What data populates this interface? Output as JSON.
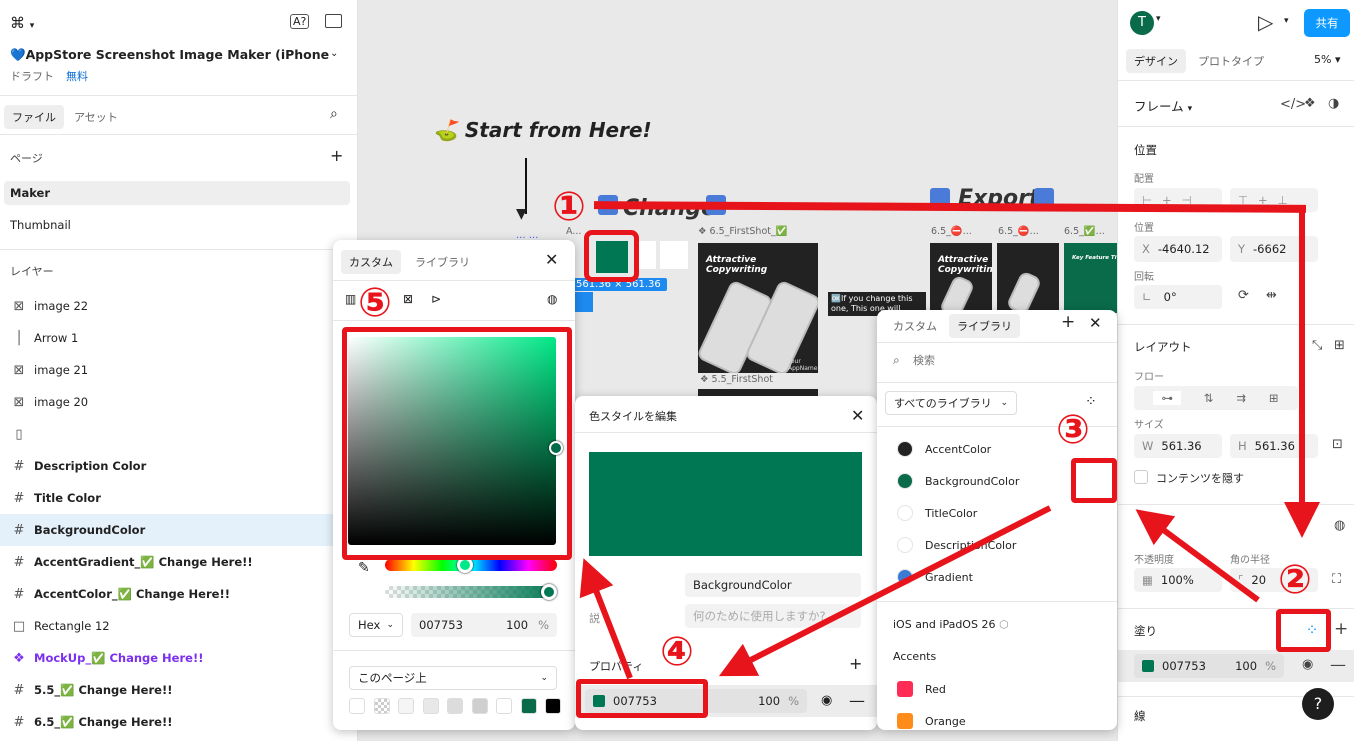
{
  "left": {
    "title": "💙AppStore Screenshot Image Maker (iPhone 1...",
    "draft": "ドラフト",
    "plan": "無料",
    "tab_file": "ファイル",
    "tab_assets": "アセット",
    "pages_label": "ページ",
    "pages": [
      "Maker",
      "Thumbnail"
    ],
    "layers_label": "レイヤー",
    "layers": [
      {
        "icon": "image-icon",
        "name": "image 22"
      },
      {
        "icon": "line-icon",
        "name": "Arrow 1"
      },
      {
        "icon": "image-icon",
        "name": "image 21"
      },
      {
        "icon": "image-icon",
        "name": "image 20"
      },
      {
        "icon": "auto-layout-icon",
        "name": ""
      },
      {
        "icon": "frame-icon",
        "name": "Description Color"
      },
      {
        "icon": "frame-icon",
        "name": "Title Color"
      },
      {
        "icon": "frame-icon",
        "name": "BackgroundColor"
      },
      {
        "icon": "frame-icon",
        "name": "AccentGradient_✅ Change Here!!"
      },
      {
        "icon": "frame-icon",
        "name": "AccentColor_✅ Change Here!!"
      },
      {
        "icon": "rect-icon",
        "name": "Rectangle 12"
      },
      {
        "icon": "component-icon",
        "name": "MockUp_✅ Change Here!!"
      },
      {
        "icon": "frame-icon",
        "name": "5.5_✅ Change Here!!"
      },
      {
        "icon": "frame-icon",
        "name": "6.5_✅ Change Here!!"
      }
    ]
  },
  "canvas": {
    "start_text": "⛳ Start from Here!",
    "change_text": "Change",
    "export_text": "Export",
    "frame_a": "A...",
    "frame_firstshot": "❖ 6.5_FirstShot_✅",
    "frame_55": "❖ 5.5_FirstShot",
    "frame_e1": "6.5_⛔...",
    "frame_e2": "6.5_⛔...",
    "frame_e3": "6.5_✅...",
    "dots": "...  ...",
    "dim_label": "561.36 × 561.36",
    "thumb_title": "Attractive Copywriting",
    "thumb_title2": "Key Feature Title",
    "note": "🆗If you change this one, This one will",
    "app_label": "Your AppName"
  },
  "color_picker": {
    "tab_custom": "カスタム",
    "tab_library": "ライブラリ",
    "format": "Hex",
    "hex": "007753",
    "opacity": "100",
    "pct": "%",
    "scope": "このページ上",
    "swatches": [
      "#ffffff",
      "checker",
      "#f5f5f5",
      "#e8e8e8",
      "#dcdcdc",
      "#cfcfcf",
      "half",
      "#0a6b4a",
      "#000000"
    ]
  },
  "style_editor": {
    "title": "色スタイルを編集",
    "name": "BackgroundColor",
    "desc_placeholder": "何のために使用しますか?",
    "desc_label": "説",
    "props_label": "プロパティ",
    "hex": "007753",
    "opacity": "100",
    "pct": "%"
  },
  "library": {
    "tab_custom": "カスタム",
    "tab_library": "ライブラリ",
    "search_placeholder": "検索",
    "filter": "すべてのライブラリ",
    "styles": [
      {
        "name": "AccentColor",
        "color": "#222222"
      },
      {
        "name": "BackgroundColor",
        "color": "#0a6b4a"
      },
      {
        "name": "TitleColor",
        "color": "#ffffff"
      },
      {
        "name": "DescriptionColor",
        "color": "#ffffff"
      },
      {
        "name": "Gradient",
        "color": "#3a7bd5"
      }
    ],
    "lib_name": "iOS and iPadOS 26",
    "group": "Accents",
    "accents": [
      {
        "name": "Red",
        "color": "#ff2d55"
      },
      {
        "name": "Orange",
        "color": "#ff8c1a"
      }
    ]
  },
  "right": {
    "avatar": "T",
    "share": "共有",
    "tab_design": "デザイン",
    "tab_proto": "プロトタイプ",
    "zoom": "5%",
    "frame_label": "フレーム",
    "position_label": "位置",
    "align_label": "配置",
    "pos_label": "位置",
    "x_label": "X",
    "x": "-4640.12",
    "y_label": "Y",
    "y": "-6662",
    "rotation_label": "回転",
    "rotation": "0°",
    "layout_label": "レイアウト",
    "flow_label": "フロー",
    "size_label": "サイズ",
    "w_label": "W",
    "w": "561.36",
    "h_label": "H",
    "h": "561.36",
    "clip": "コンテンツを隠す",
    "opacity_label": "不透明度",
    "opacity": "100%",
    "radius_label": "角の半径",
    "radius": "20",
    "fill_label": "塗り",
    "fill_hex": "007753",
    "fill_opacity": "100",
    "pct": "%",
    "stroke_label": "線",
    "help": "?"
  },
  "annotations": {
    "n1": "①",
    "n2": "②",
    "n3": "③",
    "n4": "④",
    "n5": "⑤"
  },
  "colors": {
    "accent_red": "#e8141b",
    "brand_green": "#007753",
    "blue": "#0d99ff"
  }
}
